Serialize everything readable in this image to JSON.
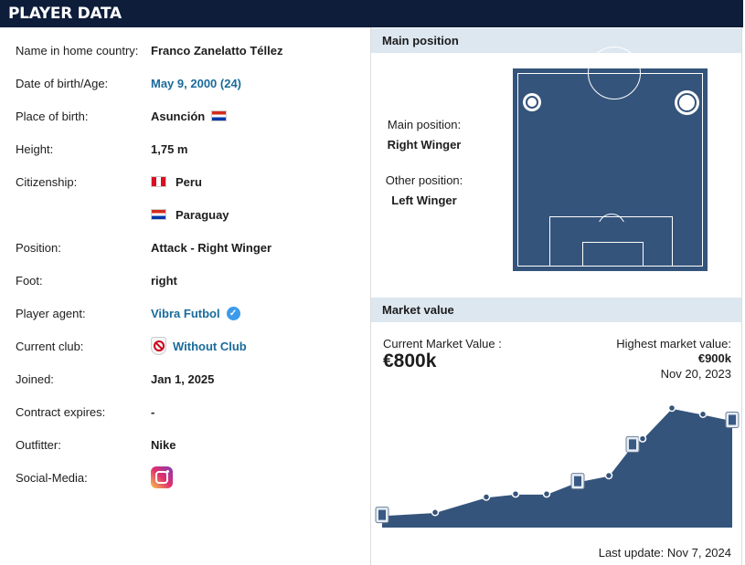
{
  "header": {
    "title": "PLAYER DATA"
  },
  "player_info": [
    {
      "label": "Name in home country:",
      "value": "Franco Zanelatto Téllez"
    },
    {
      "label": "Date of birth/Age:",
      "value": "May 9, 2000 (24)",
      "link": true
    },
    {
      "label": "Place of birth:",
      "value": "Asunción",
      "flag": "par"
    },
    {
      "label": "Height:",
      "value": "1,75 m"
    },
    {
      "label": "Citizenship:",
      "value": "Peru",
      "flag_before": "per"
    },
    {
      "label": "",
      "value": "Paraguay",
      "flag_before": "par"
    },
    {
      "label": "Position:",
      "value": "Attack - Right Winger"
    },
    {
      "label": "Foot:",
      "value": "right"
    },
    {
      "label": "Player agent:",
      "value": "Vibra Futbol",
      "link": true,
      "verified": true
    },
    {
      "label": "Current club:",
      "value": "Without Club",
      "link": true,
      "club_icon": true
    },
    {
      "label": "Joined:",
      "value": "Jan 1, 2025"
    },
    {
      "label": "Contract expires:",
      "value": "-"
    },
    {
      "label": "Outfitter:",
      "value": "Nike"
    },
    {
      "label": "Social-Media:",
      "value": "",
      "instagram": true
    }
  ],
  "main_position": {
    "section_title": "Main position",
    "main_label": "Main position:",
    "main_value": "Right Winger",
    "other_label": "Other position:",
    "other_value": "Left Winger"
  },
  "market_value": {
    "section_title": "Market value",
    "current_label": "Current Market Value :",
    "current_value": "€800k",
    "highest_label": "Highest market value:",
    "highest_value": "€900k",
    "highest_date": "Nov 20, 2023",
    "last_update": "Last update: Nov 7, 2024"
  },
  "chart_data": {
    "type": "area",
    "values": [
      25,
      50,
      175,
      200,
      200,
      300,
      350,
      600,
      650,
      900,
      850,
      800
    ],
    "ylim": [
      0,
      1000
    ],
    "fill_color": "#34547b",
    "club_crest_at": [
      0,
      5,
      7,
      11
    ]
  },
  "colors": {
    "header": "#0e1d3a",
    "section": "#dde7f0",
    "link": "#1a6b9b",
    "pitch": "#34547b"
  }
}
